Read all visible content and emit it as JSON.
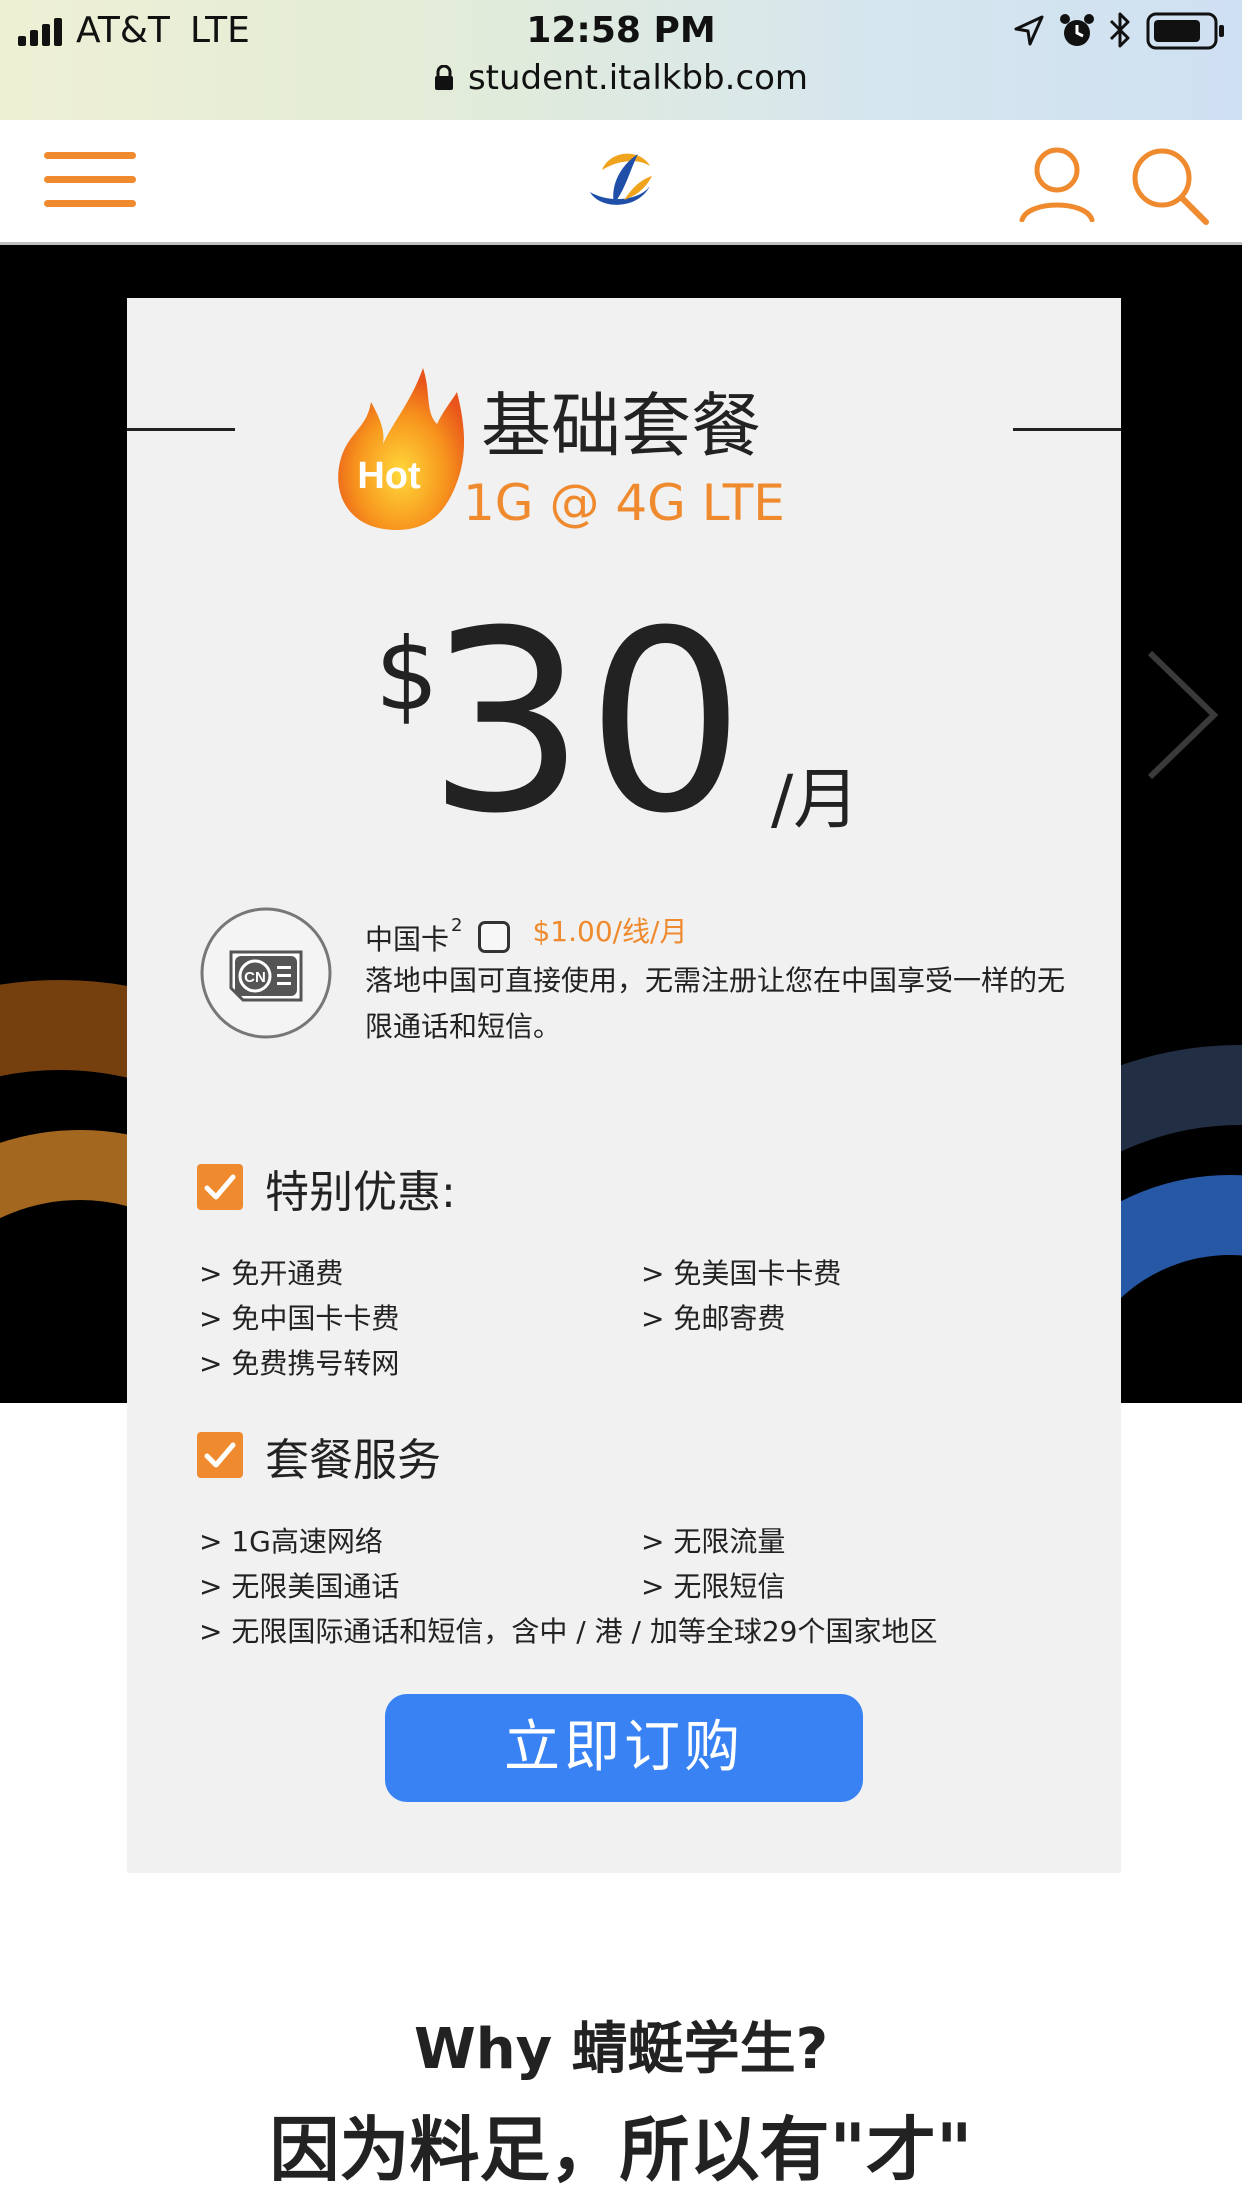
{
  "status_bar": {
    "carrier": "AT&T",
    "network": "LTE",
    "time": "12:58 PM",
    "icons": [
      "signal-icon",
      "location-icon",
      "alarm-icon",
      "bluetooth-icon",
      "battery-icon"
    ]
  },
  "browser": {
    "url": "student.italkbb.com"
  },
  "header": {
    "icons": [
      "menu-icon",
      "logo",
      "user-icon",
      "search-icon"
    ],
    "accent_color": "#ef8a2e"
  },
  "plan": {
    "badge": "Hot",
    "title": "基础套餐",
    "subtitle": "1G @ 4G LTE",
    "currency": "$",
    "price": "30",
    "unit": "/月",
    "china_card": {
      "label": "中国卡",
      "superscript": "2",
      "checked": false,
      "price": "$1.00/线/月",
      "description": "落地中国可直接使用，无需注册让您在中国享受一样的无限通话和短信。"
    },
    "special_offers": {
      "title": "特别优惠:",
      "items": [
        "> 免开通费",
        "> 免美国卡卡费",
        "> 免中国卡卡费",
        "> 免邮寄费",
        "> 免费携号转网"
      ]
    },
    "services": {
      "title": "套餐服务",
      "items": [
        "> 1G高速网络",
        "> 无限流量",
        "> 无限美国通话",
        "> 无限短信",
        "> 无限国际通话和短信，含中 / 港 / 加等全球29个国家地区"
      ]
    },
    "buy_button": "立即订购",
    "button_color": "#3882f4"
  },
  "footer_section": {
    "why": "Why 蜻蜓学生?",
    "slogan": "因为料足，所以有\"才\""
  }
}
